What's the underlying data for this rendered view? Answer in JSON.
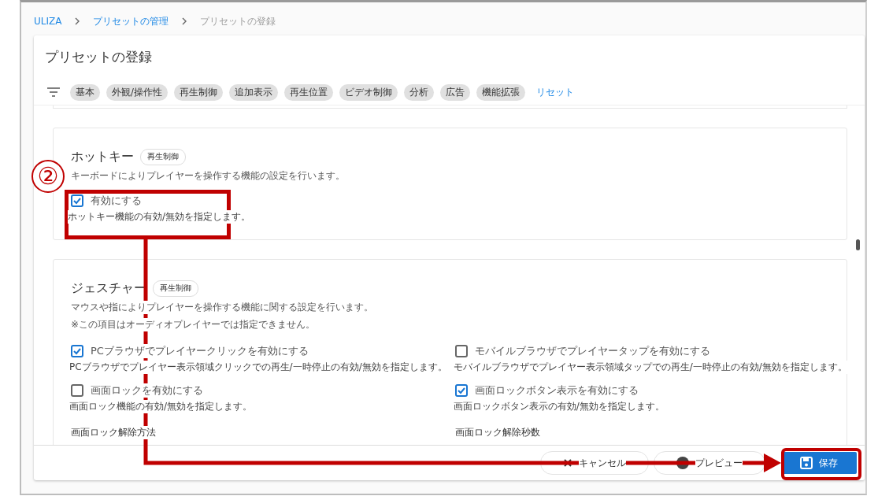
{
  "breadcrumbs": [
    {
      "label": "ULIZA",
      "kind": "link"
    },
    {
      "label": "プリセットの管理",
      "kind": "link"
    },
    {
      "label": "プリセットの登録",
      "kind": "current"
    }
  ],
  "page_title": "プリセットの登録",
  "filters": {
    "chips": [
      "基本",
      "外観/操作性",
      "再生制御",
      "追加表示",
      "再生位置",
      "ビデオ制御",
      "分析",
      "広告",
      "機能拡張"
    ],
    "reset": "リセット"
  },
  "sections": [
    {
      "title": "ホットキー",
      "tag": "再生制御",
      "descriptions": [
        "キーボードによりプレイヤーを操作する機能の設定を行います。"
      ],
      "options": [
        {
          "label": "有効にする",
          "help": "ホットキー機能の有効/無効を指定します。",
          "checked": true
        }
      ]
    },
    {
      "title": "ジェスチャー",
      "tag": "再生制御",
      "descriptions": [
        "マウスや指によりプレイヤーを操作する機能に関する設定を行います。",
        "※この項目はオーディオプレイヤーでは指定できません。"
      ],
      "options": [
        {
          "label": "PCブラウザでプレイヤークリックを有効にする",
          "help": "PCブラウザでプレイヤー表示領域クリックでの再生/一時停止の有効/無効を指定します。",
          "checked": true
        },
        {
          "label": "モバイルブラウザでプレイヤータップを有効にする",
          "help": "モバイルブラウザでプレイヤー表示領域タップでの再生/一時停止の有効/無効を指定します。",
          "checked": false
        },
        {
          "label": "画面ロックを有効にする",
          "help": "画面ロック機能の有効/無効を指定します。",
          "checked": false
        },
        {
          "label": "画面ロックボタン表示を有効にする",
          "help": "画面ロックボタン表示の有効/無効を指定します。",
          "checked": true
        }
      ],
      "fields": [
        "画面ロック解除方法",
        "画面ロック解除秒数"
      ]
    }
  ],
  "footer_buttons": [
    {
      "label": "キャンセル",
      "kind": "cancel"
    },
    {
      "label": "プレビュー",
      "kind": "preview"
    },
    {
      "label": "保存",
      "kind": "save"
    }
  ],
  "annotation": {
    "step": "②"
  }
}
